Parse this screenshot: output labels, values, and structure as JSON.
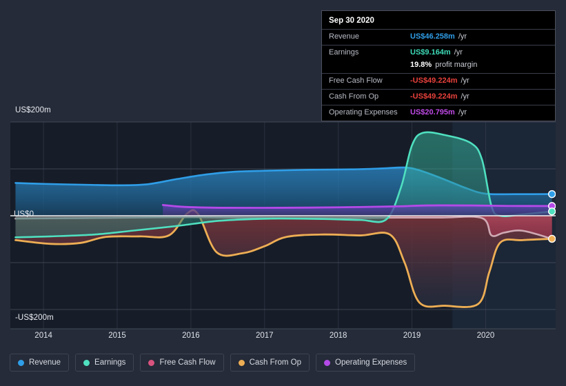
{
  "tooltip": {
    "date": "Sep 30 2020",
    "rows": [
      {
        "label": "Revenue",
        "value": "US$46.258m",
        "unit": "/yr",
        "color": "#2f9ee8"
      },
      {
        "label": "Earnings",
        "value": "US$9.164m",
        "unit": "/yr",
        "color": "#3ddbb8"
      },
      {
        "label": "",
        "value": "19.8%",
        "unit": "profit margin",
        "color": "#ffffff"
      },
      {
        "label": "Free Cash Flow",
        "value": "-US$49.224m",
        "unit": "/yr",
        "color": "#e8413c"
      },
      {
        "label": "Cash From Op",
        "value": "-US$49.224m",
        "unit": "/yr",
        "color": "#e8413c"
      },
      {
        "label": "Operating Expenses",
        "value": "US$20.795m",
        "unit": "/yr",
        "color": "#c04ae8"
      }
    ]
  },
  "legend": {
    "items": [
      {
        "label": "Revenue",
        "color": "#2f9ee8"
      },
      {
        "label": "Earnings",
        "color": "#4fe0c0"
      },
      {
        "label": "Free Cash Flow",
        "color": "#d9537f"
      },
      {
        "label": "Cash From Op",
        "color": "#eeae54"
      },
      {
        "label": "Operating Expenses",
        "color": "#b44ae8"
      }
    ]
  },
  "axes": {
    "y_labels": [
      "US$200m",
      "US$0",
      "-US$200m"
    ],
    "x_labels": [
      "2014",
      "2015",
      "2016",
      "2017",
      "2018",
      "2019",
      "2020"
    ]
  },
  "chart_data": {
    "type": "area",
    "title": "",
    "xlabel": "",
    "ylabel": "US$",
    "ylim": [
      -200,
      200
    ],
    "ytick_values": [
      200,
      100,
      0,
      -100,
      -200
    ],
    "ytick_labels": [
      "US$200m",
      "",
      "US$0",
      "",
      "-US$200m"
    ],
    "grid": true,
    "legend_position": "bottom",
    "x": [
      "2014",
      "2015",
      "2016",
      "2017",
      "2018",
      "2019",
      "2020"
    ],
    "x_range": [
      2013.55,
      2020.95
    ],
    "forecast_start": "2019.55",
    "units": "US$ millions per year",
    "series": [
      {
        "name": "Revenue",
        "color": "#2f9ee8",
        "fill": "#1d4a6e",
        "points": [
          {
            "x": 2013.62,
            "y": 70
          },
          {
            "x": 2014.0,
            "y": 68
          },
          {
            "x": 2014.6,
            "y": 66
          },
          {
            "x": 2015.0,
            "y": 65
          },
          {
            "x": 2015.4,
            "y": 67
          },
          {
            "x": 2015.8,
            "y": 78
          },
          {
            "x": 2016.2,
            "y": 88
          },
          {
            "x": 2016.6,
            "y": 94
          },
          {
            "x": 2017.0,
            "y": 96
          },
          {
            "x": 2017.6,
            "y": 98
          },
          {
            "x": 2018.2,
            "y": 99
          },
          {
            "x": 2018.6,
            "y": 101
          },
          {
            "x": 2018.9,
            "y": 103
          },
          {
            "x": 2019.1,
            "y": 97
          },
          {
            "x": 2019.4,
            "y": 80
          },
          {
            "x": 2019.75,
            "y": 58
          },
          {
            "x": 2020.0,
            "y": 47
          },
          {
            "x": 2020.4,
            "y": 46
          },
          {
            "x": 2020.9,
            "y": 46.258
          }
        ]
      },
      {
        "name": "Earnings",
        "color": "#4fe0c0",
        "fill": "#2d6f6a",
        "points": [
          {
            "x": 2013.62,
            "y": -46
          },
          {
            "x": 2014.1,
            "y": -44
          },
          {
            "x": 2014.7,
            "y": -40
          },
          {
            "x": 2015.2,
            "y": -32
          },
          {
            "x": 2015.8,
            "y": -22
          },
          {
            "x": 2016.3,
            "y": -12
          },
          {
            "x": 2016.7,
            "y": -8
          },
          {
            "x": 2017.2,
            "y": -6
          },
          {
            "x": 2017.8,
            "y": -7
          },
          {
            "x": 2018.3,
            "y": -9
          },
          {
            "x": 2018.65,
            "y": -8
          },
          {
            "x": 2018.85,
            "y": 60
          },
          {
            "x": 2019.0,
            "y": 150
          },
          {
            "x": 2019.15,
            "y": 177
          },
          {
            "x": 2019.45,
            "y": 172
          },
          {
            "x": 2019.8,
            "y": 155
          },
          {
            "x": 2019.95,
            "y": 120
          },
          {
            "x": 2020.08,
            "y": 20
          },
          {
            "x": 2020.2,
            "y": 0
          },
          {
            "x": 2020.5,
            "y": 3
          },
          {
            "x": 2020.9,
            "y": 9.164
          }
        ]
      },
      {
        "name": "Free Cash Flow",
        "color": "#cfa9b4",
        "fill": "#7e2f3d",
        "points": [
          {
            "x": 2013.62,
            "y": -6
          },
          {
            "x": 2014.5,
            "y": -5
          },
          {
            "x": 2015.2,
            "y": -4
          },
          {
            "x": 2016.0,
            "y": -3
          },
          {
            "x": 2016.6,
            "y": -4
          },
          {
            "x": 2017.3,
            "y": -5
          },
          {
            "x": 2018.0,
            "y": -5
          },
          {
            "x": 2018.8,
            "y": -4
          },
          {
            "x": 2019.4,
            "y": -4
          },
          {
            "x": 2019.95,
            "y": -5
          },
          {
            "x": 2020.08,
            "y": -42
          },
          {
            "x": 2020.25,
            "y": -36
          },
          {
            "x": 2020.5,
            "y": -32
          },
          {
            "x": 2020.9,
            "y": -49.224
          }
        ]
      },
      {
        "name": "Cash From Op",
        "color": "#eeae54",
        "fill": "#6d3d3f",
        "points": [
          {
            "x": 2013.62,
            "y": -52
          },
          {
            "x": 2014.1,
            "y": -60
          },
          {
            "x": 2014.5,
            "y": -58
          },
          {
            "x": 2014.85,
            "y": -45
          },
          {
            "x": 2015.3,
            "y": -44
          },
          {
            "x": 2015.7,
            "y": -42
          },
          {
            "x": 2015.95,
            "y": 5
          },
          {
            "x": 2016.1,
            "y": 3
          },
          {
            "x": 2016.35,
            "y": -78
          },
          {
            "x": 2016.7,
            "y": -80
          },
          {
            "x": 2017.0,
            "y": -65
          },
          {
            "x": 2017.3,
            "y": -45
          },
          {
            "x": 2017.8,
            "y": -40
          },
          {
            "x": 2018.3,
            "y": -42
          },
          {
            "x": 2018.7,
            "y": -40
          },
          {
            "x": 2018.9,
            "y": -100
          },
          {
            "x": 2019.1,
            "y": -185
          },
          {
            "x": 2019.45,
            "y": -192
          },
          {
            "x": 2019.9,
            "y": -188
          },
          {
            "x": 2020.05,
            "y": -120
          },
          {
            "x": 2020.2,
            "y": -57
          },
          {
            "x": 2020.5,
            "y": -52
          },
          {
            "x": 2020.9,
            "y": -49.224
          }
        ]
      },
      {
        "name": "Operating Expenses",
        "color": "#b44ae8",
        "fill": "#3c3470",
        "points": [
          {
            "x": 2015.62,
            "y": 23
          },
          {
            "x": 2015.9,
            "y": 19
          },
          {
            "x": 2016.4,
            "y": 17
          },
          {
            "x": 2017.2,
            "y": 17
          },
          {
            "x": 2018.0,
            "y": 18
          },
          {
            "x": 2018.8,
            "y": 20
          },
          {
            "x": 2019.2,
            "y": 22
          },
          {
            "x": 2019.8,
            "y": 22
          },
          {
            "x": 2020.3,
            "y": 21
          },
          {
            "x": 2020.9,
            "y": 20.795
          }
        ]
      }
    ]
  }
}
